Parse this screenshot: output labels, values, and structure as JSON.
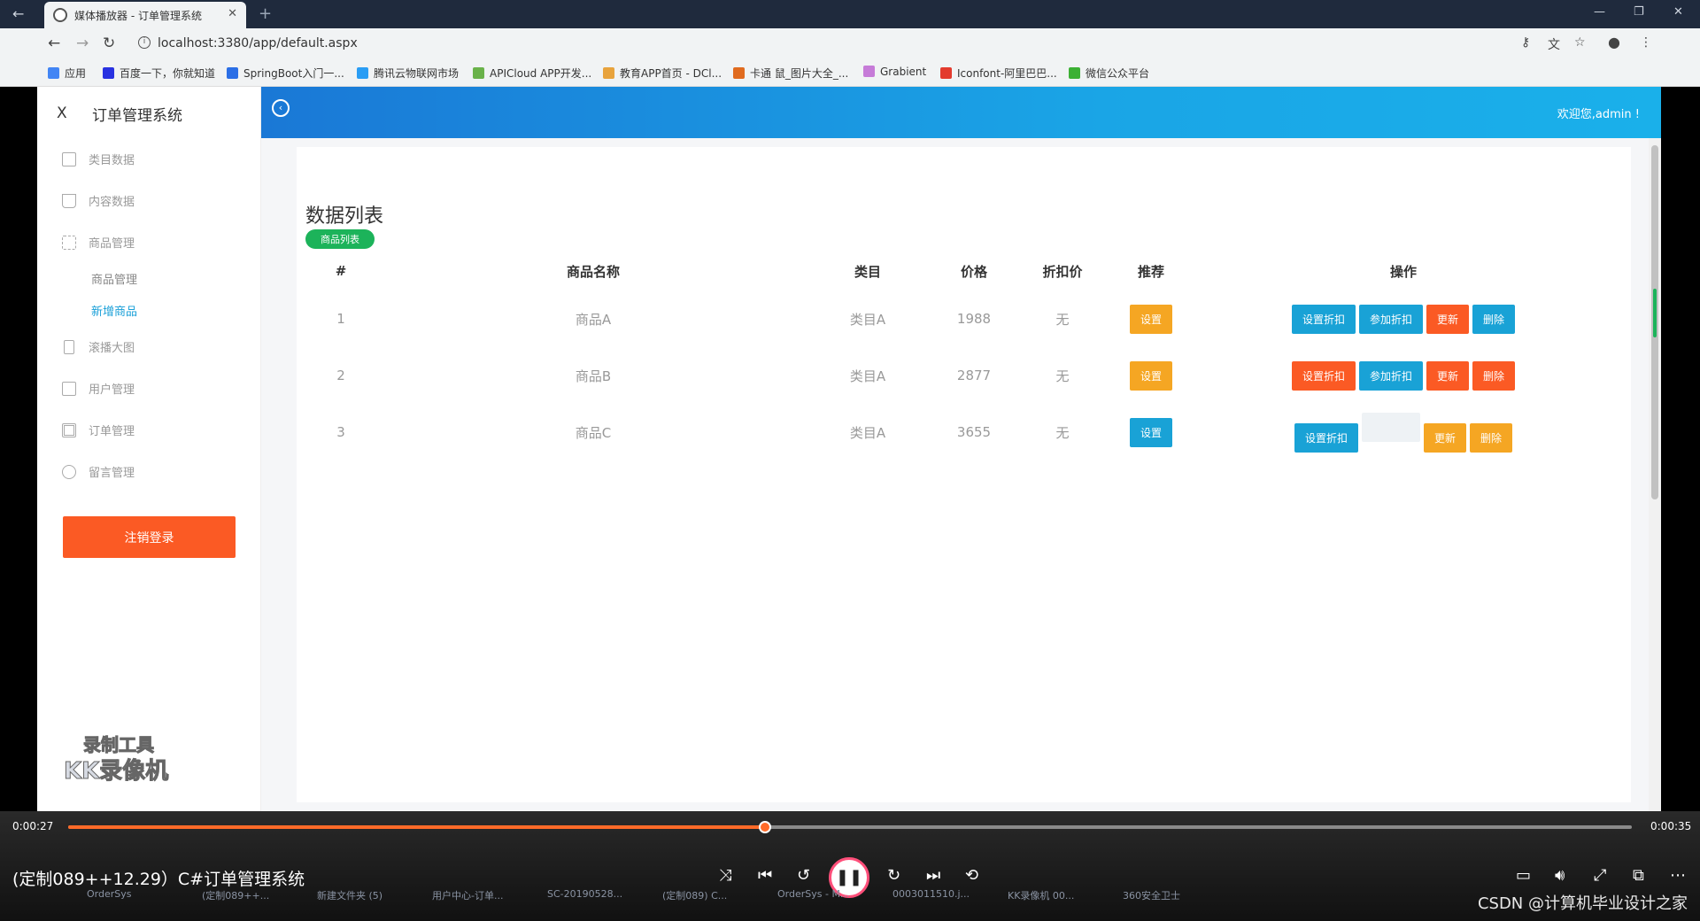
{
  "browser": {
    "tab_title": "媒体播放器 - 订单管理系统",
    "url": "localhost:3380/app/default.aspx",
    "bookmarks": [
      {
        "label": "应用",
        "color": "#4285f4"
      },
      {
        "label": "百度一下，你就知道",
        "color": "#2932e1"
      },
      {
        "label": "SpringBoot入门一...",
        "color": "#2b6fe6"
      },
      {
        "label": "腾讯云物联网市场",
        "color": "#2a9df4"
      },
      {
        "label": "APICloud APP开发...",
        "color": "#6ab24a"
      },
      {
        "label": "教育APP首页 - DCl...",
        "color": "#e8a33d"
      },
      {
        "label": "卡通 鼠_图片大全_...",
        "color": "#e06b1f"
      },
      {
        "label": "Grabient",
        "color": "#c67bd8"
      },
      {
        "label": "Iconfont-阿里巴巴...",
        "color": "#e33b2e"
      },
      {
        "label": "微信公众平台",
        "color": "#3cb034"
      }
    ]
  },
  "sidebar": {
    "close": "X",
    "title": "订单管理系统",
    "items": [
      {
        "label": "类目数据",
        "icon": "calendar-icon"
      },
      {
        "label": "内容数据",
        "icon": "cart-icon"
      },
      {
        "label": "商品管理",
        "icon": "sliders-icon"
      },
      {
        "label": "滚播大图",
        "icon": "image-icon"
      },
      {
        "label": "用户管理",
        "icon": "users-icon"
      },
      {
        "label": "订单管理",
        "icon": "grid-icon"
      },
      {
        "label": "留言管理",
        "icon": "chat-icon"
      }
    ],
    "sub_items": [
      {
        "label": "商品管理"
      },
      {
        "label": "新增商品"
      }
    ],
    "logout": "注销登录",
    "watermark_line1": "录制工具",
    "watermark_line2": "KK录像机"
  },
  "header": {
    "back_icon": "‹",
    "welcome": "欢迎您,admin !"
  },
  "main": {
    "title": "数据列表",
    "tag": "商品列表",
    "columns": [
      "#",
      "商品名称",
      "类目",
      "价格",
      "折扣价",
      "推荐",
      "操作"
    ],
    "rows": [
      {
        "id": "1",
        "name": "商品A",
        "category": "类目A",
        "price": "1988",
        "discount": "无",
        "recommend": "设置",
        "recommend_color": "orange",
        "actions": [
          "设置折扣",
          "参加折扣",
          "更新",
          "删除"
        ],
        "action_colors": [
          "blue",
          "blue",
          "red",
          "blue"
        ]
      },
      {
        "id": "2",
        "name": "商品B",
        "category": "类目A",
        "price": "2877",
        "discount": "无",
        "recommend": "设置",
        "recommend_color": "orange",
        "actions": [
          "设置折扣",
          "参加折扣",
          "更新",
          "删除"
        ],
        "action_colors": [
          "red",
          "blue",
          "red",
          "red"
        ]
      },
      {
        "id": "3",
        "name": "商品C",
        "category": "类目A",
        "price": "3655",
        "discount": "无",
        "recommend": "设置",
        "recommend_color": "blue",
        "actions": [
          "设置折扣",
          "",
          "更新",
          "删除"
        ],
        "action_colors": [
          "blue",
          "ghost",
          "orange",
          "orange"
        ]
      }
    ]
  },
  "player": {
    "elapsed": "0:00:27",
    "total": "0:00:35",
    "progress": 0.446,
    "title": "(定制089++12.29）C#订单管理系统",
    "credit": "CSDN @计算机毕业设计之家"
  },
  "taskbar": [
    "OrderSys",
    "(定制089++...",
    "新建文件夹 (5)",
    "用户中心-订单...",
    "SC-20190528...",
    "(定制089) C...",
    "OrderSys - M...",
    "0003011510.j...",
    "KK录像机 00...",
    "360安全卫士"
  ]
}
